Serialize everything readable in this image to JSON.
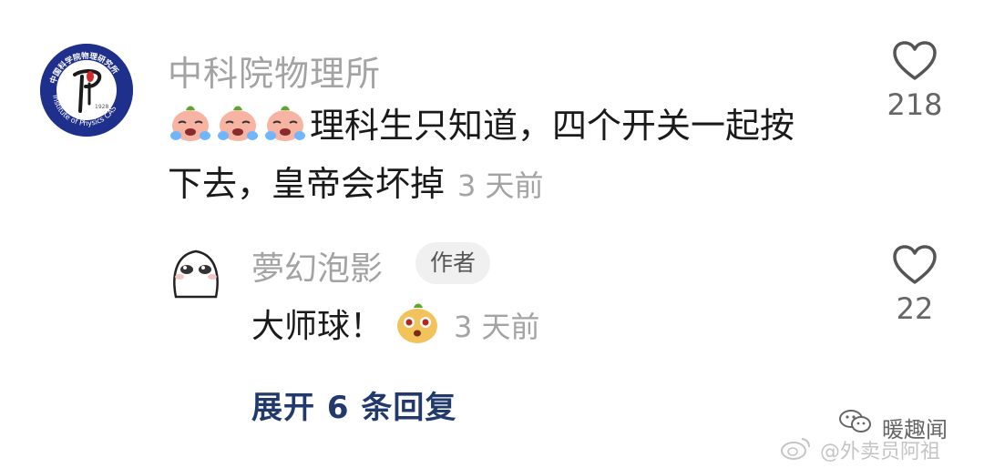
{
  "comment": {
    "author": "中科院物理所",
    "avatar_icon": "institute-of-physics-cas-logo-icon",
    "avatar_logo_text": "中国科学院物理研究所 Institute of Physics CAS",
    "text_line1": "理科生只知道，四个开关一起按",
    "text_line2": "下去，皇帝会坏掉",
    "emoji_icon": "crying-peach-emoji",
    "time": "3 天前",
    "like_count": "218"
  },
  "reply": {
    "author": "夢幻泡影",
    "badge": "作者",
    "text": "大师球！",
    "emoji_icon": "shocked-peach-emoji",
    "time": "3 天前",
    "like_count": "22"
  },
  "expand_replies": "展开 6 条回复",
  "watermark": {
    "wechat_name": "暖趣闻",
    "weibo_name": "@外卖员阿祖"
  },
  "colors": {
    "secondary_text": "#a3a3a3",
    "primary_text": "#1a1a1a",
    "link_dark_blue": "#213a6b",
    "logo_blue": "#1e2f8c"
  }
}
